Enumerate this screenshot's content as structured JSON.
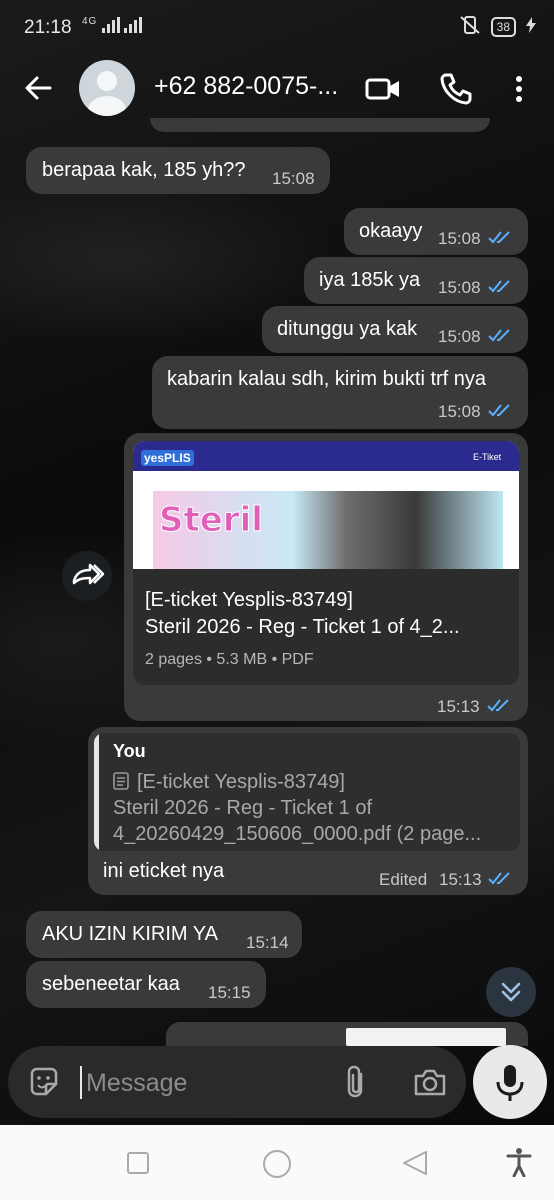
{
  "status_bar": {
    "time": "21:18",
    "network": "4G",
    "battery": "38"
  },
  "header": {
    "contact": "+62 882-0075-..."
  },
  "messages": [
    {
      "text": "berapaa kak, 185 yh??",
      "time": "15:08"
    },
    {
      "text": "okaayy",
      "time": "15:08"
    },
    {
      "text": "iya 185k ya",
      "time": "15:08"
    },
    {
      "text": "ditunggu ya kak",
      "time": "15:08"
    },
    {
      "text": "kabarin kalau sdh, kirim bukti trf nya",
      "time": "15:08"
    },
    {
      "doc_brand": "yesPLIS",
      "doc_badge": "E-Tiket",
      "doc_title_1": "[E-ticket Yesplis-83749]",
      "doc_title_2": "Steril 2026 - Reg - Ticket 1 of 4_2...",
      "doc_meta": "2 pages • 5.3 MB • PDF",
      "time": "15:13"
    },
    {
      "quote_author": "You",
      "quote_line_1": "[E-ticket Yesplis-83749]",
      "quote_line_2": "Steril 2026 - Reg - Ticket 1 of",
      "quote_line_3": "4_20260429_150606_0000.pdf (2 page...",
      "text": "ini eticket nya",
      "edited": "Edited",
      "time": "15:13"
    },
    {
      "text": "AKU IZIN KIRIM YA",
      "time": "15:14"
    },
    {
      "text": "sebeneetar kaa",
      "time": "15:15"
    }
  ],
  "composer": {
    "placeholder": "Message"
  },
  "colors": {
    "bubble": "#3a3a3a",
    "read_tick": "#5ab0ff",
    "background": "#0c0c0c"
  }
}
